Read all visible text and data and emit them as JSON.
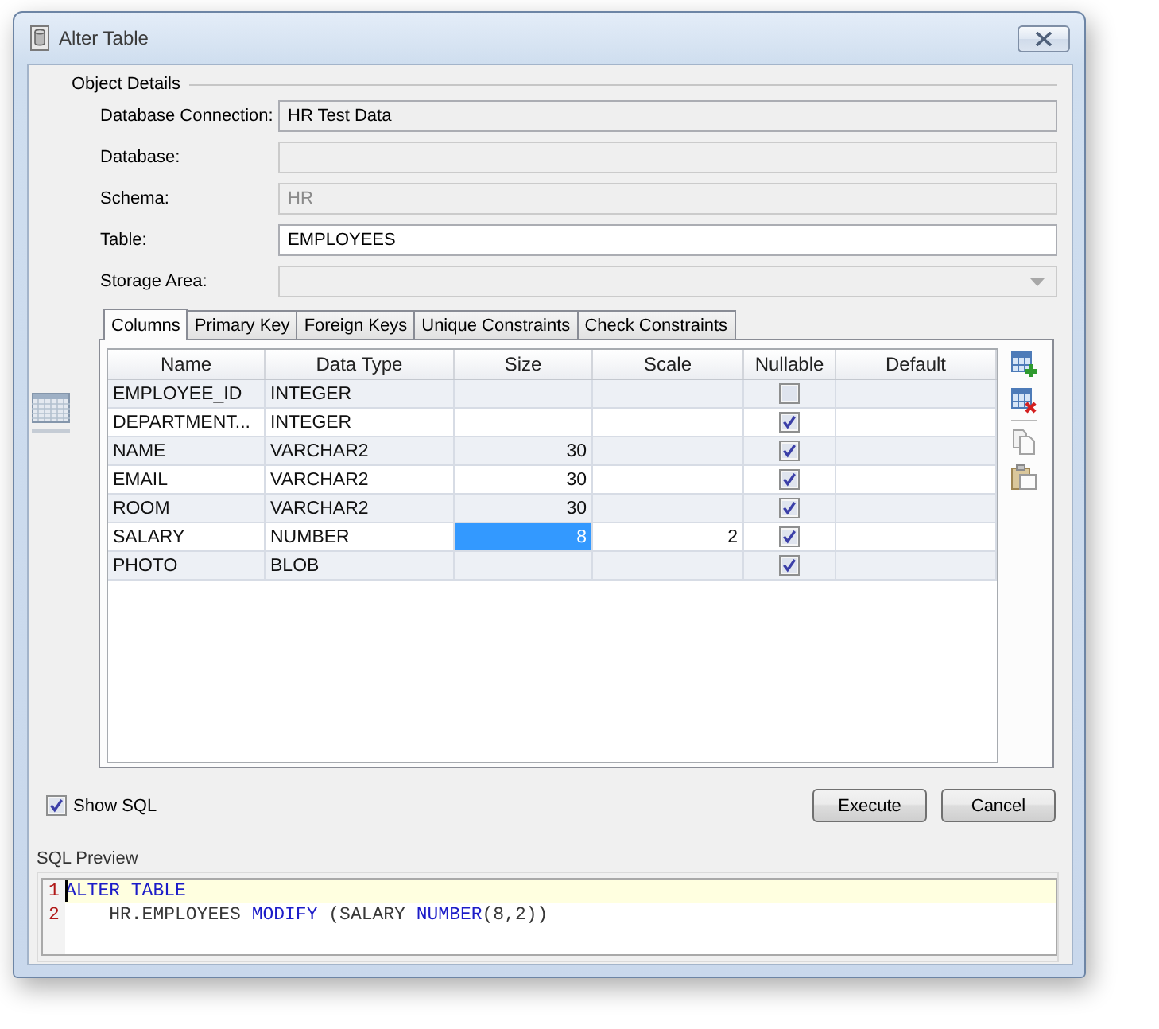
{
  "window": {
    "title": "Alter Table"
  },
  "object_details": {
    "title": "Object Details",
    "fields": [
      {
        "label": "Database Connection:",
        "kind": "text",
        "value": "HR Test Data",
        "read_only": true,
        "disabled": false
      },
      {
        "label": "Database:",
        "kind": "text",
        "read_only": true,
        "disabled": true
      },
      {
        "label": "Schema:",
        "kind": "text",
        "value": "HR",
        "read_only": true,
        "disabled": true
      },
      {
        "label": "Table:",
        "kind": "text",
        "value": "EMPLOYEES",
        "read_only": false,
        "disabled": false
      },
      {
        "label": "Storage Area:",
        "kind": "dropdown",
        "read_only": true,
        "disabled": true
      }
    ]
  },
  "tabs": [
    {
      "label": "Columns",
      "selected": true
    },
    {
      "label": "Primary Key",
      "selected": false
    },
    {
      "label": "Foreign Keys",
      "selected": false
    },
    {
      "label": "Unique Constraints",
      "selected": false
    },
    {
      "label": "Check Constraints",
      "selected": false
    }
  ],
  "table": {
    "columns": [
      "Name",
      "Data Type",
      "Size",
      "Scale",
      "Nullable",
      "Default"
    ],
    "rows": [
      {
        "name": "EMPLOYEE_ID",
        "data_type": "INTEGER",
        "nullable": false,
        "size_selected": false
      },
      {
        "name": "DEPARTMENT...",
        "data_type": "INTEGER",
        "nullable": true,
        "size_selected": false
      },
      {
        "name": "NAME",
        "data_type": "VARCHAR2",
        "size": "30",
        "nullable": true,
        "size_selected": false
      },
      {
        "name": "EMAIL",
        "data_type": "VARCHAR2",
        "size": "30",
        "nullable": true,
        "size_selected": false
      },
      {
        "name": "ROOM",
        "data_type": "VARCHAR2",
        "size": "30",
        "nullable": true,
        "size_selected": false
      },
      {
        "name": "SALARY",
        "data_type": "NUMBER",
        "size": "8",
        "scale": "2",
        "nullable": true,
        "size_selected": true
      },
      {
        "name": "PHOTO",
        "data_type": "BLOB",
        "nullable": true,
        "size_selected": false
      }
    ]
  },
  "show_sql": {
    "label": "Show SQL",
    "checked": true
  },
  "buttons": [
    "Execute",
    "Cancel"
  ],
  "sql_preview": {
    "title": "SQL Preview",
    "lines": [
      {
        "number": "1",
        "current": true,
        "indented": false,
        "tokens": [
          {
            "text": "ALTER TABLE",
            "kind": "keyword"
          }
        ]
      },
      {
        "number": "2",
        "current": false,
        "indented": true,
        "tokens": [
          {
            "text": "HR.EMPLOYEES ",
            "kind": "plain"
          },
          {
            "text": "MODIFY",
            "kind": "keyword"
          },
          {
            "text": " (SALARY ",
            "kind": "plain"
          },
          {
            "text": "NUMBER",
            "kind": "keyword"
          },
          {
            "text": "(8,2))",
            "kind": "plain"
          }
        ]
      }
    ]
  }
}
